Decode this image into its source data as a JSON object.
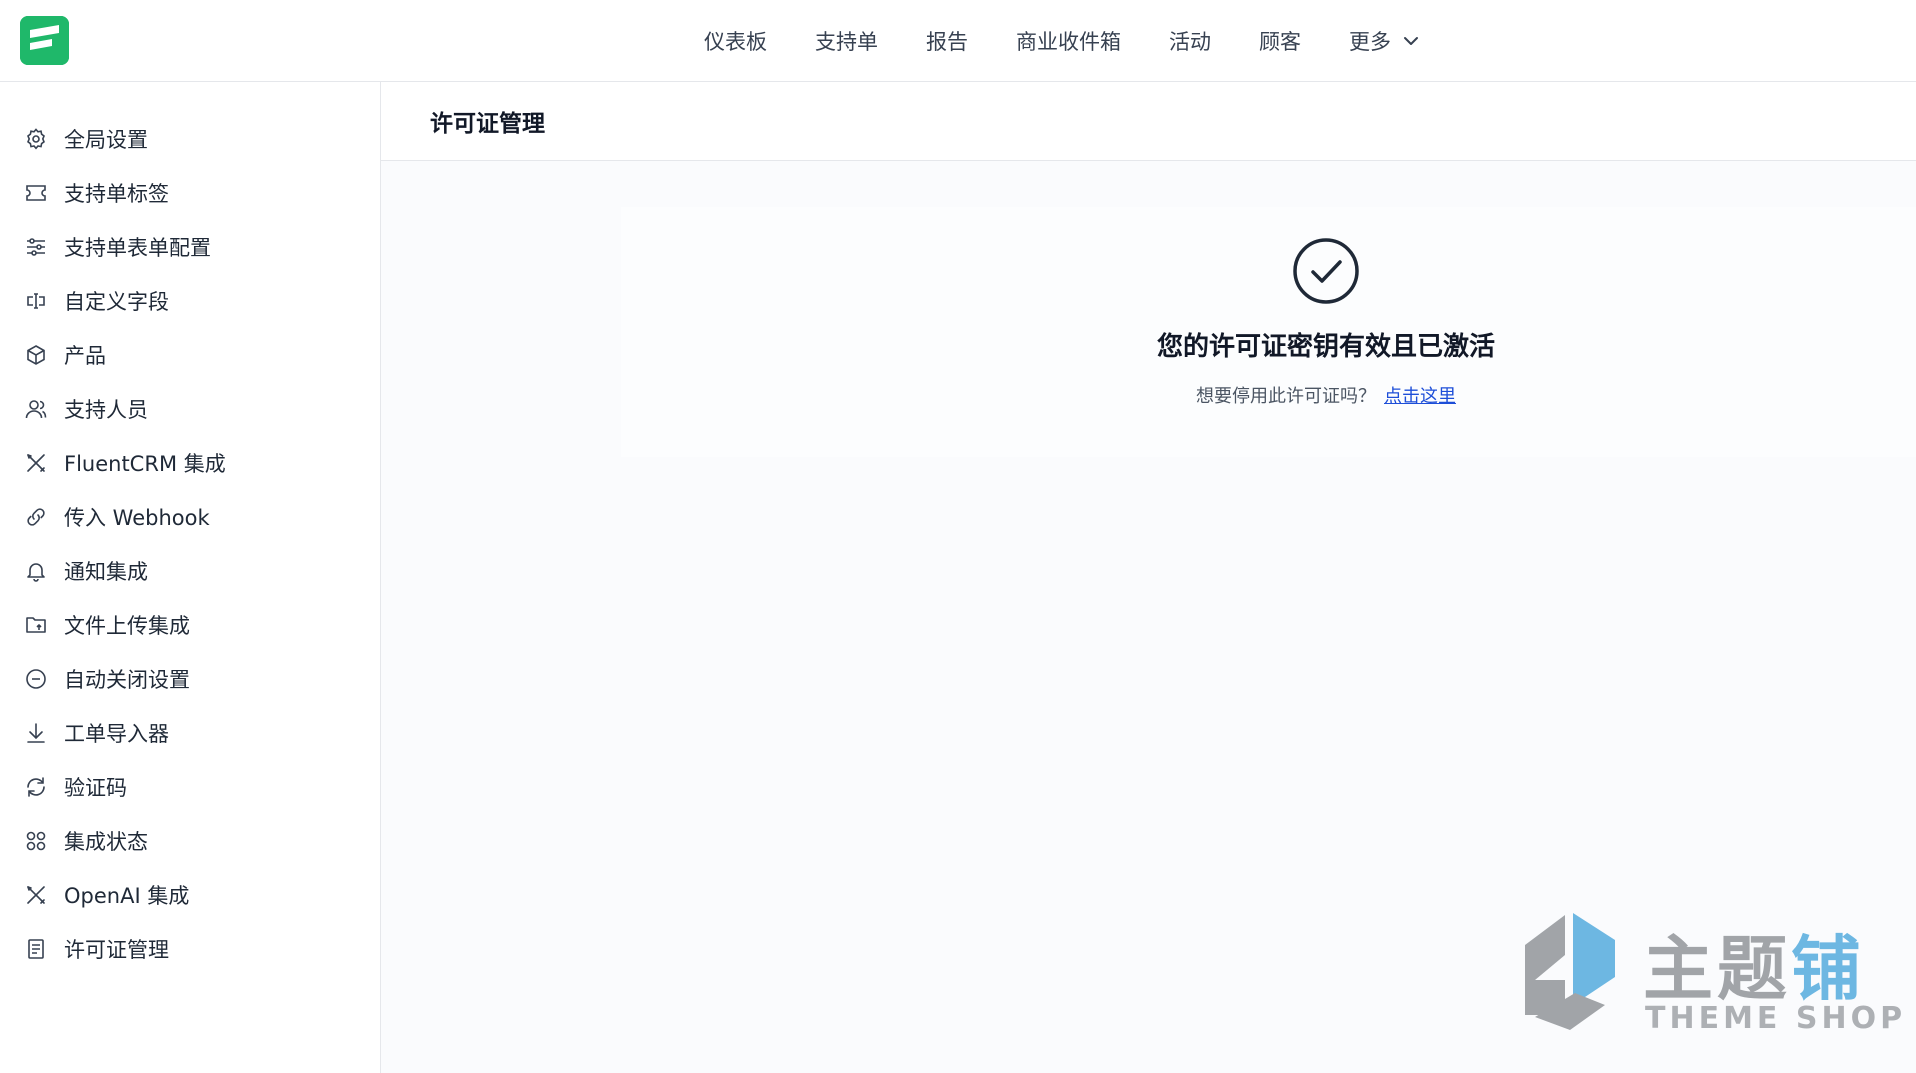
{
  "app": {
    "logo_icon": "fluent-support-logo",
    "brand_color": "#1fb86a"
  },
  "top_nav": {
    "items": [
      {
        "label": "仪表板"
      },
      {
        "label": "支持单"
      },
      {
        "label": "报告"
      },
      {
        "label": "商业收件箱"
      },
      {
        "label": "活动"
      },
      {
        "label": "顾客"
      }
    ],
    "more_label": "更多",
    "more_icon": "chevron-down-icon"
  },
  "sidebar": {
    "items": [
      {
        "label": "全局设置",
        "icon": "gear-icon"
      },
      {
        "label": "支持单标签",
        "icon": "ticket-icon"
      },
      {
        "label": "支持单表单配置",
        "icon": "sliders-icon"
      },
      {
        "label": "自定义字段",
        "icon": "text-cursor-icon"
      },
      {
        "label": "产品",
        "icon": "box-icon"
      },
      {
        "label": "支持人员",
        "icon": "users-icon"
      },
      {
        "label": "FluentCRM 集成",
        "icon": "tools-icon"
      },
      {
        "label": "传入 Webhook",
        "icon": "webhook-icon"
      },
      {
        "label": "通知集成",
        "icon": "bell-icon"
      },
      {
        "label": "文件上传集成",
        "icon": "folder-upload-icon"
      },
      {
        "label": "自动关闭设置",
        "icon": "minus-circle-icon"
      },
      {
        "label": "工单导入器",
        "icon": "download-icon"
      },
      {
        "label": "验证码",
        "icon": "refresh-icon"
      },
      {
        "label": "集成状态",
        "icon": "grid-circles-icon"
      },
      {
        "label": "OpenAI 集成",
        "icon": "tools-icon"
      },
      {
        "label": "许可证管理",
        "icon": "document-icon"
      }
    ]
  },
  "main": {
    "title": "许可证管理",
    "status_icon": "check-circle-icon",
    "status_title": "您的许可证密钥有效且已激活",
    "deactivate_prompt": "想要停用此许可证吗？",
    "deactivate_link": "点击这里"
  },
  "watermark": {
    "text_cn_part1": "主题",
    "text_cn_part2": "铺",
    "text_en": "THEME SHOP"
  }
}
